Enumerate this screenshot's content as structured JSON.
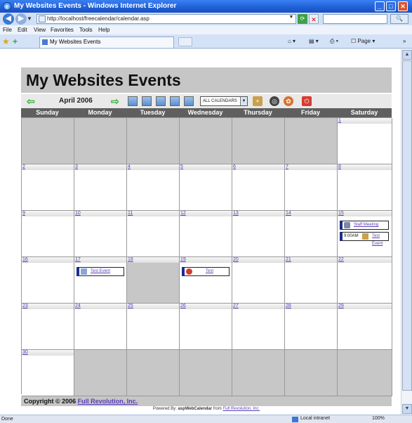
{
  "window": {
    "title": "My Websites Events - Windows Internet Explorer"
  },
  "browser": {
    "url": "http://localhost/freecalendar/calendar.asp",
    "menu": [
      "File",
      "Edit",
      "View",
      "Favorites",
      "Tools",
      "Help"
    ],
    "tab_title": "My Websites Events",
    "commands": {
      "page": "Page"
    },
    "status": "Done",
    "zone": "Local intranet",
    "zoom": "100%"
  },
  "calendar": {
    "title": "My Websites Events",
    "month": "April 2006",
    "calendar_select": "ALL CALENDARS",
    "days": [
      "Sunday",
      "Monday",
      "Tuesday",
      "Wednesday",
      "Thursday",
      "Friday",
      "Saturday"
    ],
    "weeks": [
      [
        "",
        "",
        "",
        "",
        "",
        "",
        "1"
      ],
      [
        "2",
        "3",
        "4",
        "5",
        "6",
        "7",
        "8"
      ],
      [
        "9",
        "10",
        "11",
        "12",
        "13",
        "14",
        "15"
      ],
      [
        "16",
        "17",
        "18",
        "19",
        "20",
        "21",
        "22"
      ],
      [
        "23",
        "24",
        "25",
        "26",
        "27",
        "28",
        "29"
      ],
      [
        "30",
        "",
        "",
        "",
        "",
        "",
        ""
      ]
    ],
    "events": {
      "staff_meeting": "Staff Meeting",
      "test_event_time": "9:00AM",
      "test_event_sat": "Test Event",
      "test_event_mon": "Test Event",
      "test_wed": "Test"
    },
    "footer": {
      "copyright": "Copyright © 2006",
      "company": "Full Revolution, Inc.",
      "powered_prefix": "Powered By:",
      "product": "aspWebCalendar",
      "from": "from",
      "powered_company": "Full Revolution, Inc."
    }
  }
}
